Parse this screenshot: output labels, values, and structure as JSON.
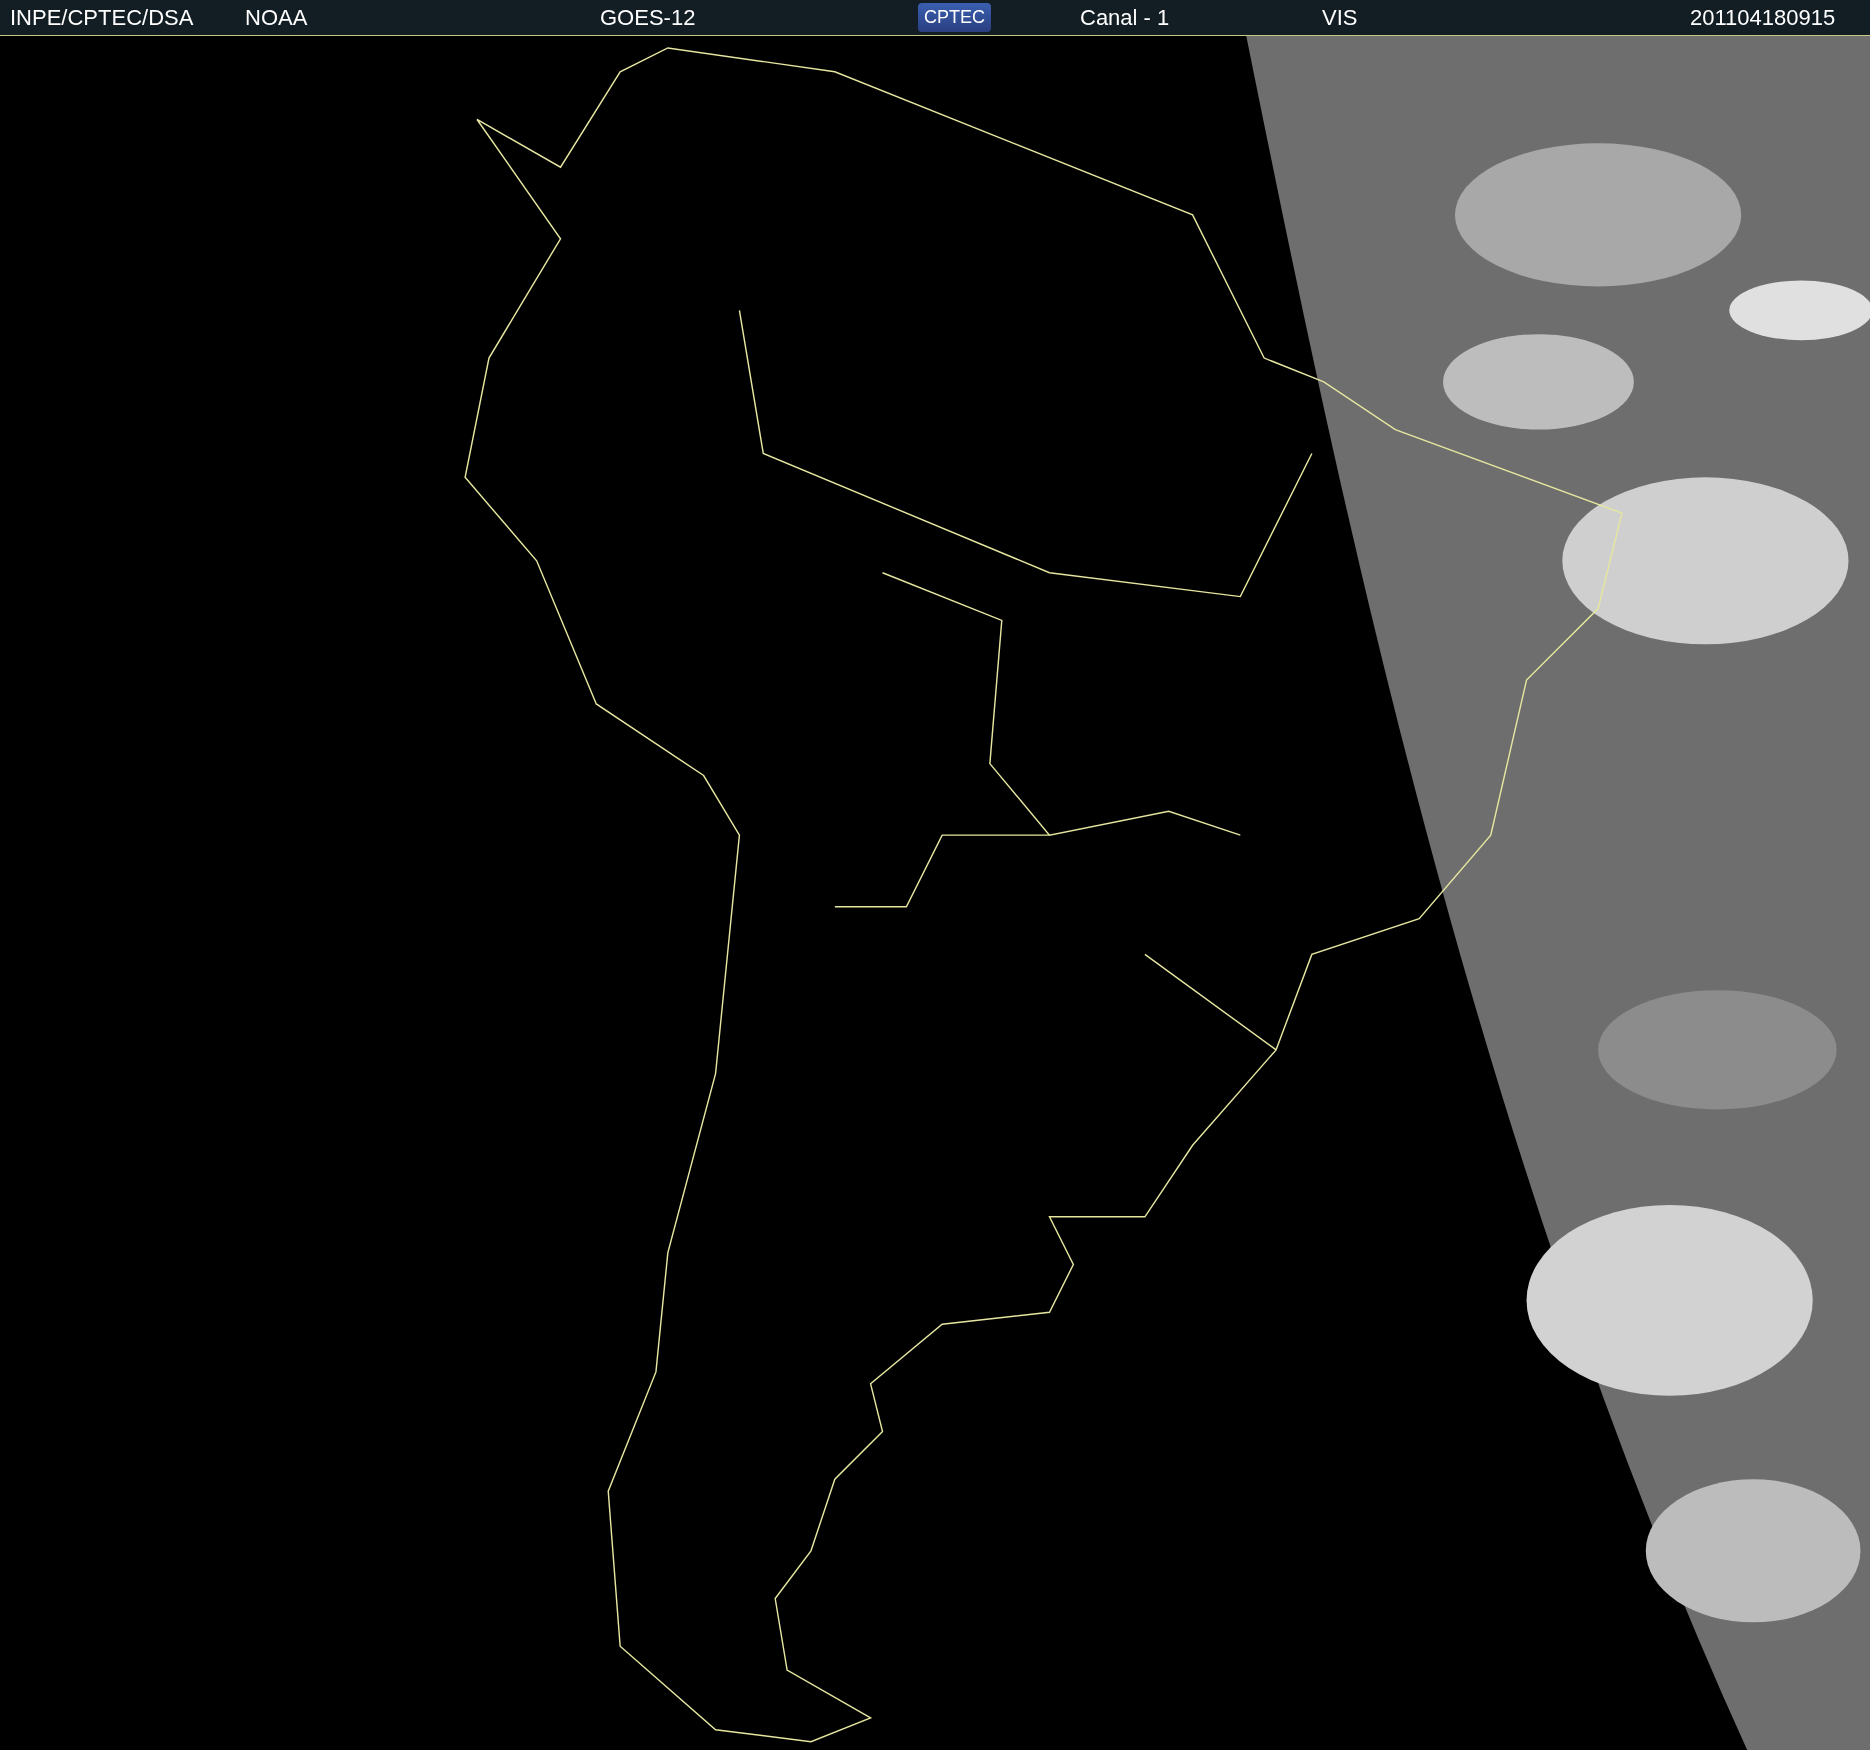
{
  "header": {
    "source": "INPE/CPTEC/DSA",
    "agency": "NOAA",
    "satellite": "GOES-12",
    "logo": "CPTEC",
    "channel": "Canal - 1",
    "band": "VIS",
    "timestamp": "201104180915"
  }
}
